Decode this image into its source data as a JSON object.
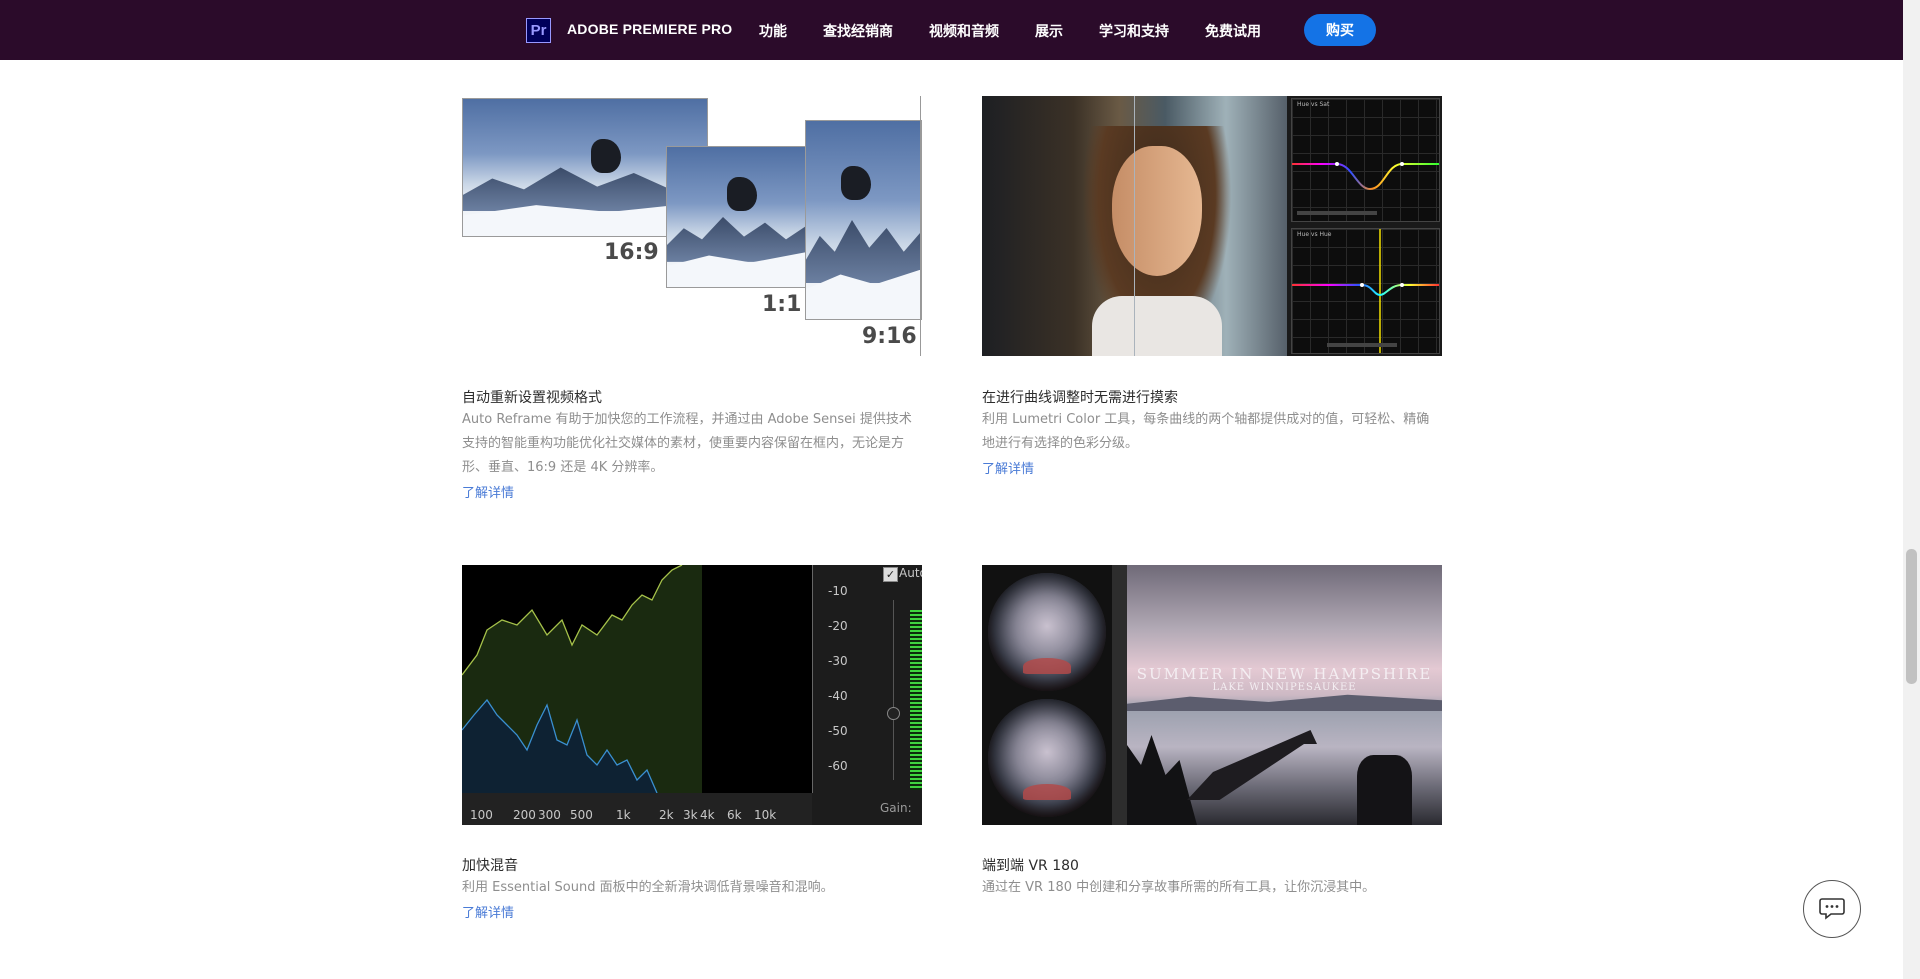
{
  "nav": {
    "brand": "ADOBE PREMIERE PRO",
    "logo_text": "Pr",
    "items": [
      "功能",
      "查找经销商",
      "视频和音频",
      "展示",
      "学习和支持",
      "免费试用"
    ],
    "buy_label": "购买",
    "colors": {
      "background": "#2b0b2a",
      "buy_button": "#1473e6"
    }
  },
  "cards": [
    {
      "title": "自动重新设置视频格式",
      "description": "Auto Reframe 有助于加快您的工作流程，并通过由 Adobe Sensei 提供技术支持的智能重构功能优化社交媒体的素材，使重要内容保留在框内，无论是方形、垂直、16:9 还是 4K 分辨率。",
      "link": "了解详情",
      "image": {
        "ratios": [
          "16:9",
          "1:1",
          "9:16"
        ]
      }
    },
    {
      "title": "在进行曲线调整时无需进行摸索",
      "description": "利用 Lumetri Color 工具，每条曲线的两个轴都提供成对的值，可轻松、精确地进行有选择的色彩分级。",
      "link": "了解详情",
      "image": {
        "panel_labels": [
          "Hue vs Sat",
          "Hue vs Hue"
        ]
      }
    },
    {
      "title": "加快混音",
      "description": "利用 Essential Sound 面板中的全新滑块调低背景噪音和混响。",
      "link": "了解详情",
      "image": {
        "db_labels": [
          "-10",
          "-20",
          "-30",
          "-40",
          "-50",
          "-60"
        ],
        "freq_labels": [
          "100",
          "200",
          "300",
          "500",
          "1k",
          "2k",
          "3k",
          "4k",
          "6k",
          "10k"
        ],
        "auto_label": "Auto",
        "gain_label": "Gain:"
      }
    },
    {
      "title": "端到端 VR 180",
      "description": "通过在 VR 180 中创建和分享故事所需的所有工具，让你沉浸其中。",
      "image": {
        "overlay_title": "SUMMER IN NEW HAMPSHIRE",
        "overlay_subtitle": "LAKE WINNIPESAUKEE"
      }
    }
  ],
  "chat": {
    "icon": "chat-bubble-icon"
  },
  "colors": {
    "link": "#4a7bd6",
    "description": "#8e8e8e",
    "title": "#2c2c2c"
  }
}
